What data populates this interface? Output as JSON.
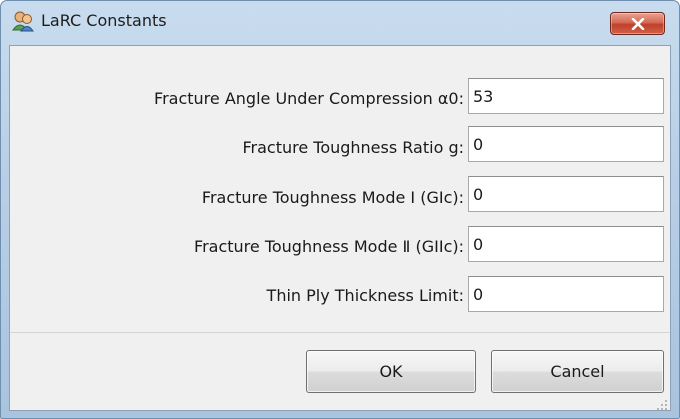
{
  "window": {
    "title": "LaRC Constants",
    "icon": "users-icon",
    "close_icon": "close-icon",
    "accent_close": "#c9452f"
  },
  "form": {
    "rows": [
      {
        "label": "Fracture Angle Under Compression α0:",
        "value": "53"
      },
      {
        "label": "Fracture Toughness Ratio g:",
        "value": "0"
      },
      {
        "label": "Fracture Toughness Mode I (GIc):",
        "value": "0"
      },
      {
        "label": "Fracture Toughness Mode Ⅱ (GIIc):",
        "value": "0"
      },
      {
        "label": "Thin Ply Thickness Limit:",
        "value": "0"
      }
    ]
  },
  "buttons": {
    "ok_label": "OK",
    "cancel_label": "Cancel"
  }
}
